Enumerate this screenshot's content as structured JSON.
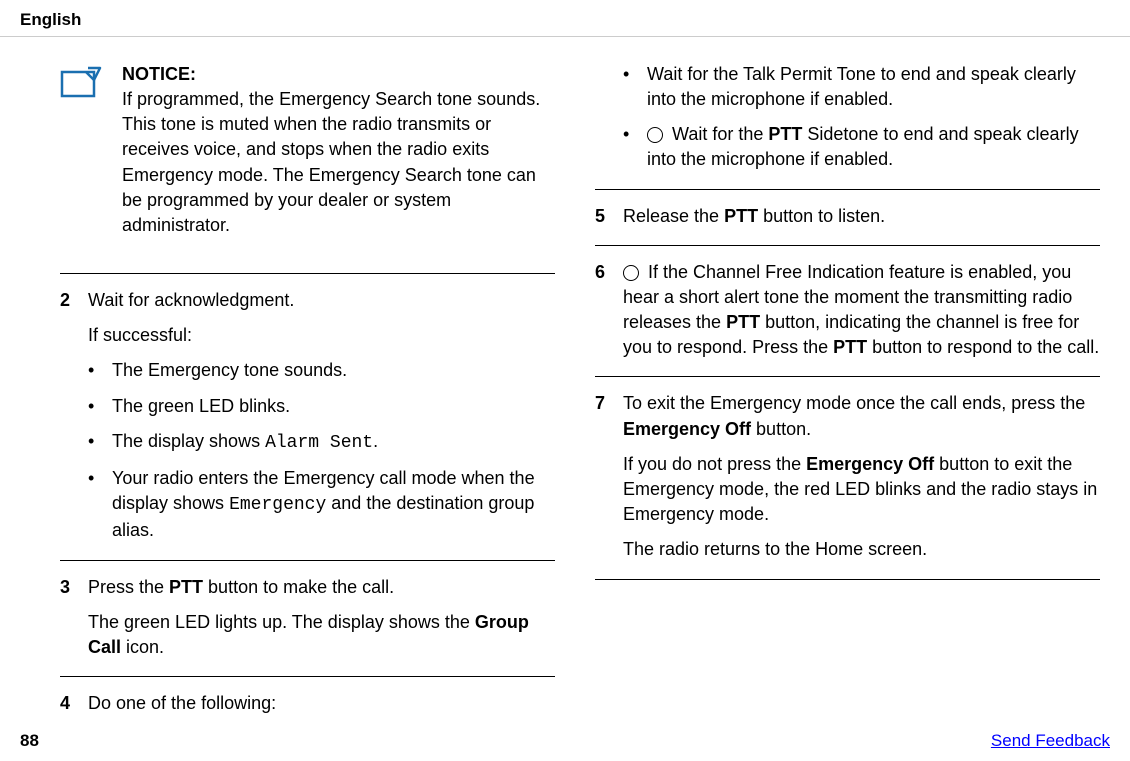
{
  "header": {
    "language": "English"
  },
  "left": {
    "notice": {
      "title": "NOTICE:",
      "body": "If programmed, the Emergency Search tone sounds. This tone is muted when the radio transmits or receives voice, and stops when the radio exits Emergency mode. The Emergency Search tone can be programmed by your dealer or system administrator."
    },
    "step2": {
      "num": "2",
      "line1": "Wait for acknowledgment.",
      "line2": "If successful:",
      "b1": "The Emergency tone sounds.",
      "b2": "The green LED blinks.",
      "b3_pre": "The display shows ",
      "b3_mono": "Alarm Sent",
      "b3_post": ".",
      "b4_pre": "Your radio enters the Emergency call mode when the display shows ",
      "b4_mono": "Emergency",
      "b4_post": " and the destination group alias."
    },
    "step3": {
      "num": "3",
      "line1_a": "Press the ",
      "line1_b": "PTT",
      "line1_c": " button to make the call.",
      "line2_a": "The green LED lights up. The display shows the ",
      "line2_b": "Group Call",
      "line2_c": " icon."
    },
    "step4": {
      "num": "4",
      "line1": "Do one of the following:"
    }
  },
  "right": {
    "step4_cont": {
      "b1": "Wait for the Talk Permit Tone to end and speak clearly into the microphone if enabled.",
      "b2_a": " Wait for the ",
      "b2_b": "PTT",
      "b2_c": " Sidetone to end and speak clearly into the microphone if enabled."
    },
    "step5": {
      "num": "5",
      "a": "Release the ",
      "b": "PTT",
      "c": " button to listen."
    },
    "step6": {
      "num": "6",
      "a": " If the Channel Free Indication feature is enabled, you hear a short alert tone the moment the transmitting radio releases the ",
      "b": "PTT",
      "c": " button, indicating the channel is free for you to respond. Press the ",
      "d": "PTT",
      "e": " button to respond to the call."
    },
    "step7": {
      "num": "7",
      "l1a": "To exit the Emergency mode once the call ends, press the ",
      "l1b": "Emergency Off",
      "l1c": " button.",
      "l2a": "If you do not press the ",
      "l2b": "Emergency Off",
      "l2c": " button to exit the Emergency mode, the red LED blinks and the radio stays in Emergency mode.",
      "l3": "The radio returns to the Home screen."
    }
  },
  "footer": {
    "page": "88",
    "feedback": "Send Feedback"
  }
}
